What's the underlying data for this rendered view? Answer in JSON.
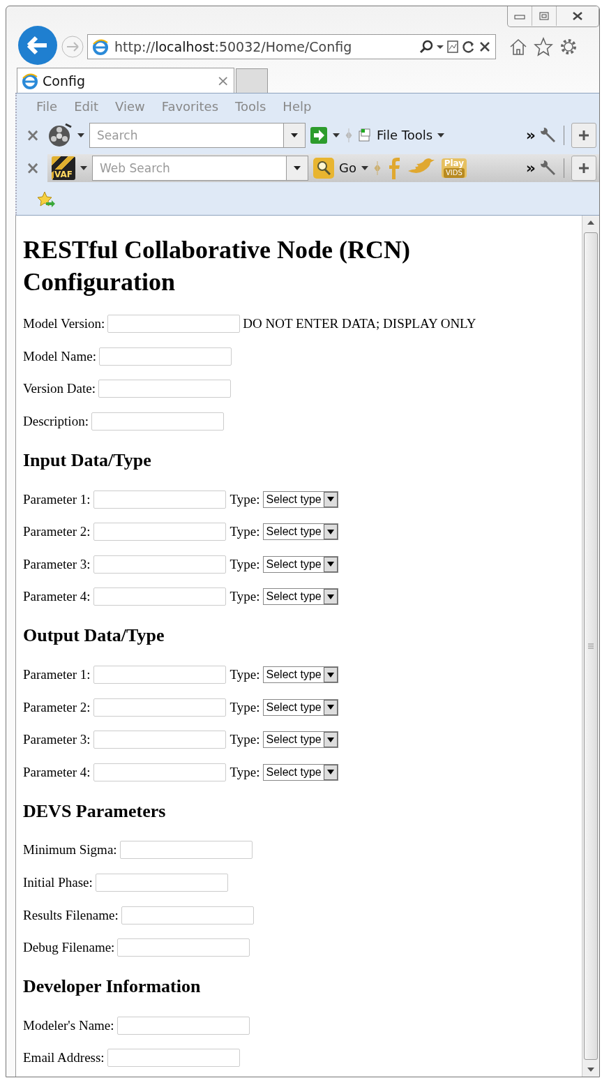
{
  "browser": {
    "address": {
      "scheme": "http://",
      "host": "localhost",
      "rest": ":50032/Home/Config"
    },
    "tabs": [
      {
        "title": "Config",
        "close": "×",
        "selected": true
      },
      {
        "selected": false
      }
    ],
    "menu": [
      "File",
      "Edit",
      "View",
      "Favorites",
      "Tools",
      "Help"
    ],
    "toolbar_1": {
      "close": "×",
      "search_placeholder": "Search",
      "file_tools": "File Tools",
      "more": "»"
    },
    "toolbar_2": {
      "close": "×",
      "logo": "VAF",
      "search_placeholder": "Web Search",
      "go": "Go",
      "play": "Play",
      "vids": "VIDS",
      "more": "»"
    }
  },
  "page": {
    "title": "RESTful Collaborative Node (RCN) Configuration",
    "sections": [
      {
        "fields": [
          {
            "kind": "note",
            "label": "Model Version:",
            "note": "DO NOT ENTER DATA; DISPLAY ONLY"
          },
          {
            "kind": "text",
            "label": "Model Name:"
          },
          {
            "kind": "text",
            "label": "Version Date:"
          },
          {
            "kind": "text",
            "label": "Description:"
          }
        ]
      },
      {
        "heading": "Input Data/Type",
        "fields": [
          {
            "kind": "typed",
            "label": "Parameter 1:",
            "type_label": "Type:",
            "select": "Select type"
          },
          {
            "kind": "typed",
            "label": "Parameter 2:",
            "type_label": "Type:",
            "select": "Select type"
          },
          {
            "kind": "typed",
            "label": "Parameter 3:",
            "type_label": "Type:",
            "select": "Select type"
          },
          {
            "kind": "typed",
            "label": "Parameter 4:",
            "type_label": "Type:",
            "select": "Select type"
          }
        ]
      },
      {
        "heading": "Output Data/Type",
        "fields": [
          {
            "kind": "typed",
            "label": "Parameter 1:",
            "type_label": "Type:",
            "select": "Select type"
          },
          {
            "kind": "typed",
            "label": "Parameter 2:",
            "type_label": "Type:",
            "select": "Select type"
          },
          {
            "kind": "typed",
            "label": "Parameter 3:",
            "type_label": "Type:",
            "select": "Select type"
          },
          {
            "kind": "typed",
            "label": "Parameter 4:",
            "type_label": "Type:",
            "select": "Select type"
          }
        ]
      },
      {
        "heading": "DEVS Parameters",
        "fields": [
          {
            "kind": "text",
            "label": "Minimum Sigma:"
          },
          {
            "kind": "text",
            "label": "Initial Phase:"
          },
          {
            "kind": "text",
            "label": "Results Filename:"
          },
          {
            "kind": "text",
            "label": "Debug Filename:"
          }
        ]
      },
      {
        "heading": "Developer Information",
        "fields": [
          {
            "kind": "text",
            "label": "Modeler's Name:"
          },
          {
            "kind": "text",
            "label": "Email Address:"
          }
        ]
      }
    ]
  }
}
